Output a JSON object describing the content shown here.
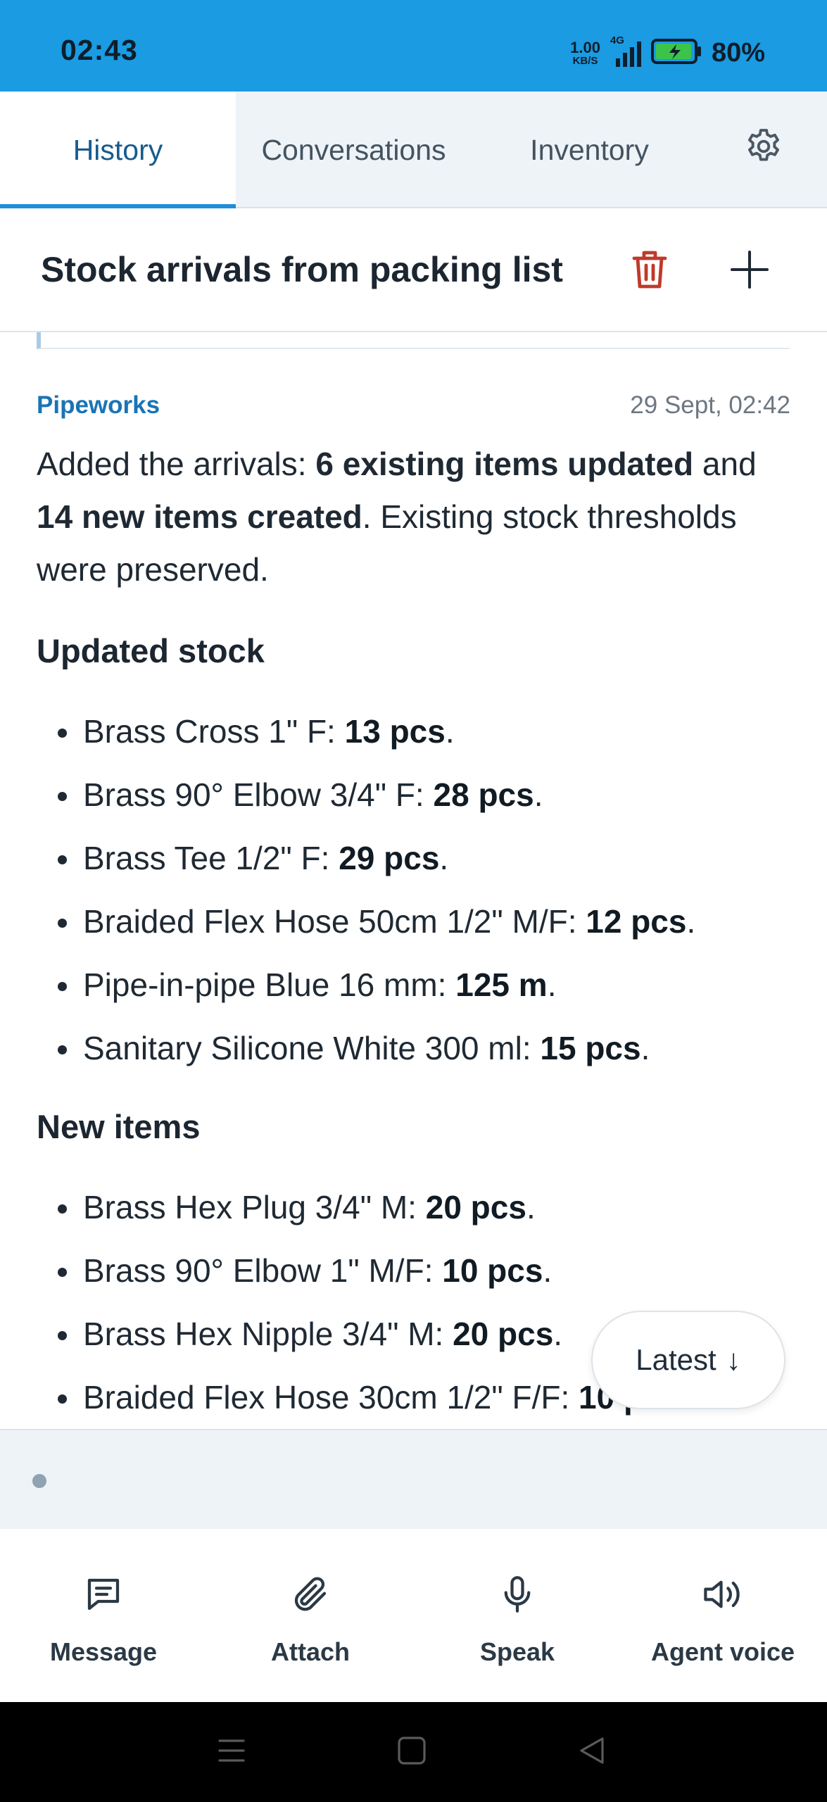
{
  "status_bar": {
    "time": "02:43",
    "net_speed_value": "1.00",
    "net_speed_unit": "KB/S",
    "network_type": "4G",
    "battery_percent": "80%"
  },
  "tabs": [
    {
      "label": "History",
      "active": true
    },
    {
      "label": "Conversations",
      "active": false
    },
    {
      "label": "Inventory",
      "active": false
    }
  ],
  "header": {
    "title": "Stock arrivals from packing list"
  },
  "message": {
    "sender": "Pipeworks",
    "timestamp": "29 Sept, 02:42",
    "intro_1": "Added the arrivals: ",
    "intro_bold_1": "6 existing items updated",
    "intro_2": " and ",
    "intro_bold_2": "14 new items created",
    "intro_3": ". Existing stock thresholds were preserved.",
    "updated_heading": "Updated stock",
    "updated_items": [
      {
        "name": "Brass Cross 1\" F: ",
        "qty": "13 pcs",
        "end": "."
      },
      {
        "name": "Brass 90° Elbow 3/4\" F: ",
        "qty": "28 pcs",
        "end": "."
      },
      {
        "name": "Brass Tee 1/2\" F: ",
        "qty": "29 pcs",
        "end": "."
      },
      {
        "name": "Braided Flex Hose 50cm 1/2\" M/F: ",
        "qty": "12 pcs",
        "end": "."
      },
      {
        "name": "Pipe-in-pipe Blue 16 mm: ",
        "qty": "125 m",
        "end": "."
      },
      {
        "name": "Sanitary Silicone White 300 ml: ",
        "qty": "15 pcs",
        "end": "."
      }
    ],
    "new_heading": "New items",
    "new_items": [
      {
        "name": "Brass Hex Plug 3/4\" M: ",
        "qty": "20 pcs",
        "end": "."
      },
      {
        "name": "Brass 90° Elbow 1\" M/F: ",
        "qty": "10 pcs",
        "end": "."
      },
      {
        "name": "Brass Hex Nipple 3/4\" M: ",
        "qty": "20 pcs",
        "end": "."
      },
      {
        "name": "Braided Flex Hose 30cm 1/2\" F/F: ",
        "qty": "10 pcs",
        "end": "."
      }
    ]
  },
  "latest_button": {
    "label": "Latest",
    "arrow": "↓"
  },
  "actions": [
    {
      "label": "Message",
      "icon": "message-icon"
    },
    {
      "label": "Attach",
      "icon": "paperclip-icon"
    },
    {
      "label": "Speak",
      "icon": "microphone-icon"
    },
    {
      "label": "Agent voice",
      "icon": "speaker-icon"
    }
  ],
  "colors": {
    "status_bar": "#1a9be2",
    "accent": "#1e8ed8",
    "sender": "#1a74b5",
    "trash": "#c0392b"
  }
}
